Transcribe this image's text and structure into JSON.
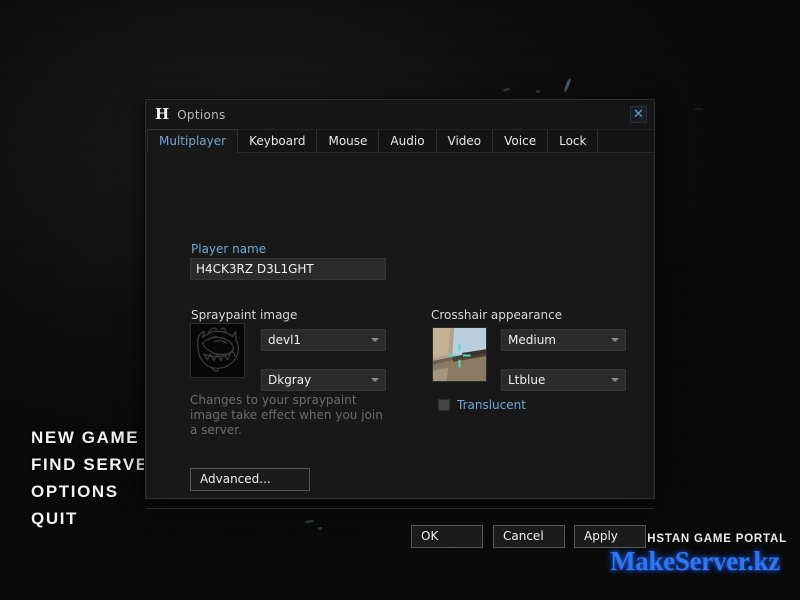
{
  "background": {
    "noise_color": "#0d0d0d"
  },
  "main_menu": {
    "items": [
      {
        "label": "NEW GAME"
      },
      {
        "label": "FIND SERVERS"
      },
      {
        "label": "OPTIONS"
      },
      {
        "label": "QUIT"
      }
    ]
  },
  "watermark": {
    "top_line": "KAZAKHSTAN GAME PORTAL",
    "main_line": "MakeServer.kz",
    "main_color": "#2f76ef"
  },
  "dialog": {
    "logo_glyph": "H",
    "title": "Options",
    "close_icon": "close-icon",
    "close_glyph": "✕",
    "accent_color": "#6fa8d8",
    "tabs": [
      {
        "label": "Multiplayer",
        "active": true
      },
      {
        "label": "Keyboard",
        "active": false
      },
      {
        "label": "Mouse",
        "active": false
      },
      {
        "label": "Audio",
        "active": false
      },
      {
        "label": "Video",
        "active": false
      },
      {
        "label": "Voice",
        "active": false
      },
      {
        "label": "Lock",
        "active": false
      }
    ],
    "multiplayer": {
      "player_name": {
        "label": "Player name",
        "value": "H4CK3RZ D3L1GHT",
        "placeholder": "Player name"
      },
      "spraypaint": {
        "label": "Spraypaint image",
        "image_name": "devil-face-spray-thumbnail",
        "image_selected": "devl1",
        "color_selected": "Dkgray",
        "note": "Changes to your spraypaint image take effect when you join a server."
      },
      "crosshair": {
        "label": "Crosshair appearance",
        "image_name": "crosshair-preview-thumbnail",
        "size_selected": "Medium",
        "color_selected": "Ltblue",
        "translucent_label": "Translucent",
        "translucent_checked": false
      },
      "advanced_button": "Advanced..."
    },
    "footer": {
      "ok": "OK",
      "cancel": "Cancel",
      "apply": "Apply"
    }
  }
}
